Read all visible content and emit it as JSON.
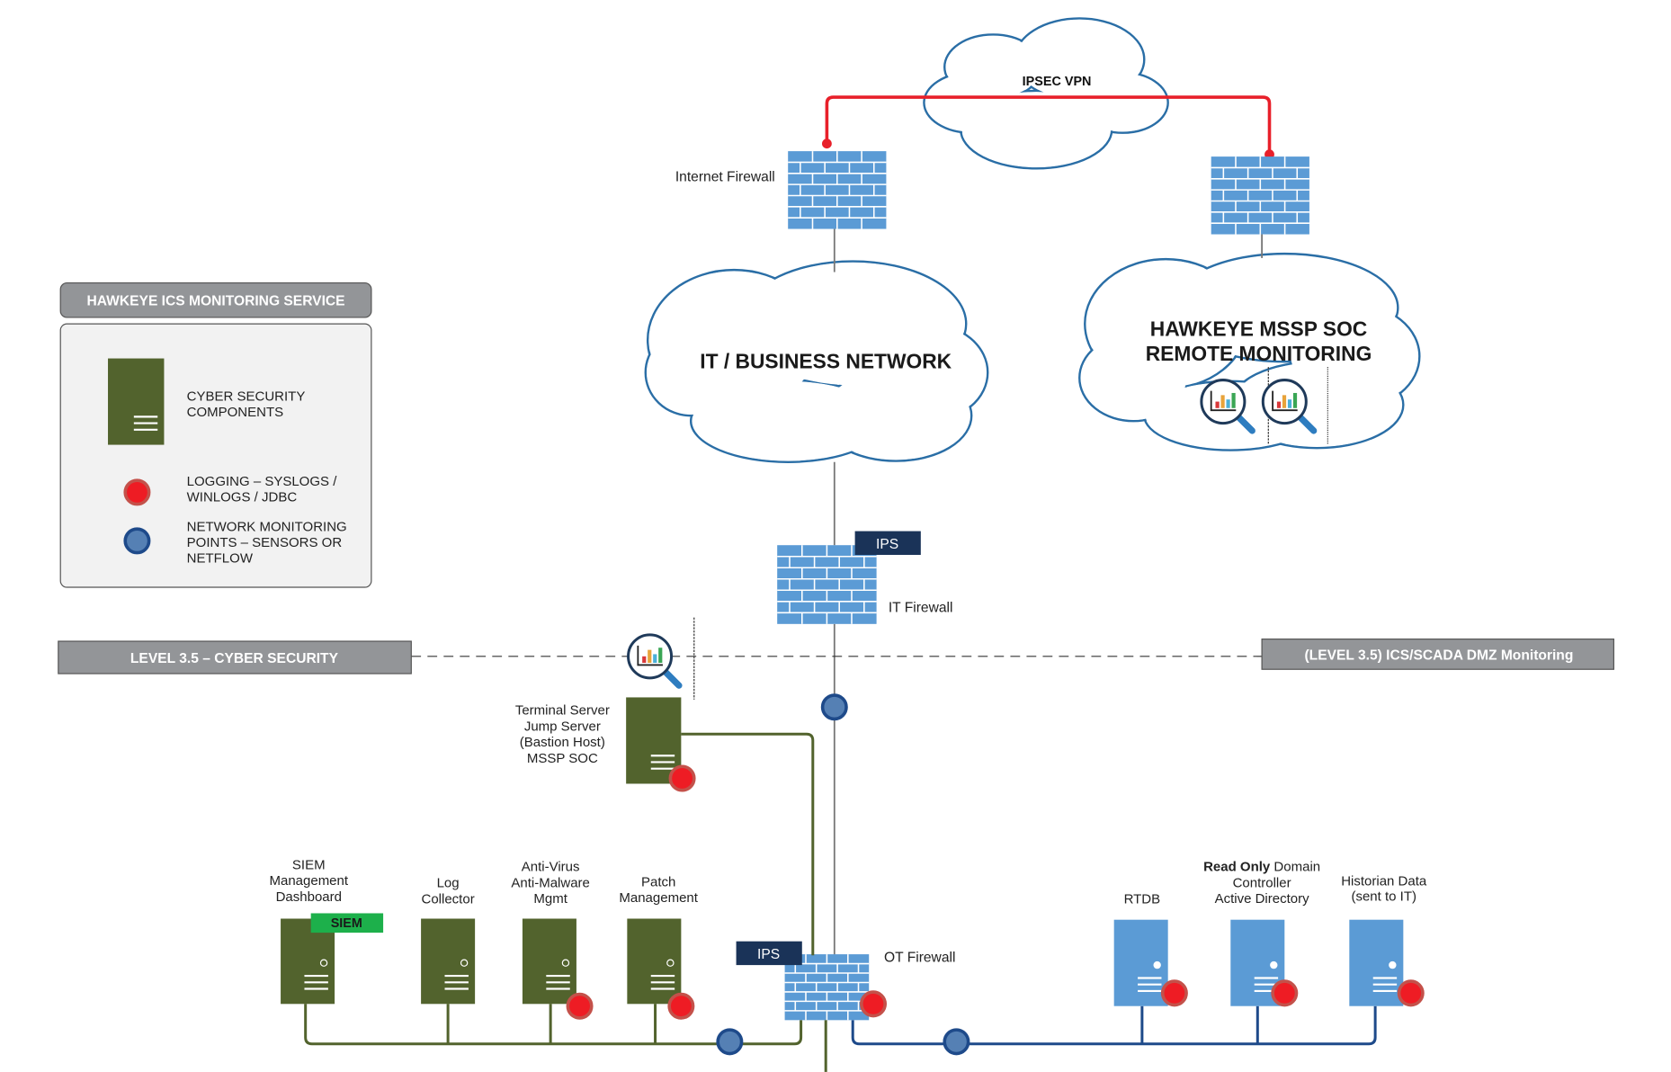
{
  "colors": {
    "vpn": "#e8202a",
    "cloud": "#2a6ea6",
    "firewall": "#5b9bd5",
    "cyber_server": "#52632d",
    "ot_server": "#5b9bd5",
    "logging": "#ee1c24",
    "monitoring": "#5580b4",
    "ips": "#1a3358",
    "siem": "#1db04b",
    "label_box": "#939598"
  },
  "vpn": {
    "label": "IPSEC VPN"
  },
  "internet_firewall": {
    "label": "Internet Firewall"
  },
  "it_cloud": {
    "label": "IT / BUSINESS NETWORK"
  },
  "soc_cloud": {
    "line1": "HAWKEYE MSSP SOC",
    "line2": "REMOTE MONITORING"
  },
  "legend": {
    "title": "HAWKEYE ICS MONITORING SERVICE",
    "items": [
      {
        "icon": "server-icon",
        "lines": [
          "CYBER SECURITY",
          "COMPONENTS"
        ]
      },
      {
        "icon": "logging-dot-icon",
        "lines": [
          "LOGGING – SYSLOGS /",
          "WINLOGS / JDBC"
        ]
      },
      {
        "icon": "monitoring-dot-icon",
        "lines": [
          "NETWORK MONITORING",
          "POINTS – SENSORS OR",
          "NETFLOW"
        ]
      }
    ]
  },
  "it_firewall": {
    "label": "IT Firewall",
    "badge": "IPS"
  },
  "levels": {
    "left": "LEVEL 3.5 – CYBER SECURITY",
    "right": "(LEVEL 3.5) ICS/SCADA DMZ Monitoring"
  },
  "terminal_server": {
    "lines": [
      "Terminal Server",
      "Jump Server",
      "(Bastion Host)",
      "MSSP SOC"
    ]
  },
  "ot_firewall": {
    "label": "OT Firewall",
    "badge": "IPS"
  },
  "cyber_servers": [
    {
      "lines": [
        "SIEM",
        "Management",
        "Dashboard"
      ],
      "tag": "SIEM"
    },
    {
      "lines": [
        "Log",
        "Collector"
      ]
    },
    {
      "lines": [
        "Anti-Virus",
        "Anti-Malware",
        "Mgmt"
      ]
    },
    {
      "lines": [
        "Patch",
        "Management"
      ]
    }
  ],
  "ot_servers": [
    {
      "lines": [
        "RTDB"
      ]
    },
    {
      "bold": "Read Only",
      "lines": [
        " Domain",
        "Controller",
        "Active Directory"
      ]
    },
    {
      "lines": [
        "Historian Data",
        "(sent to IT)"
      ]
    }
  ]
}
